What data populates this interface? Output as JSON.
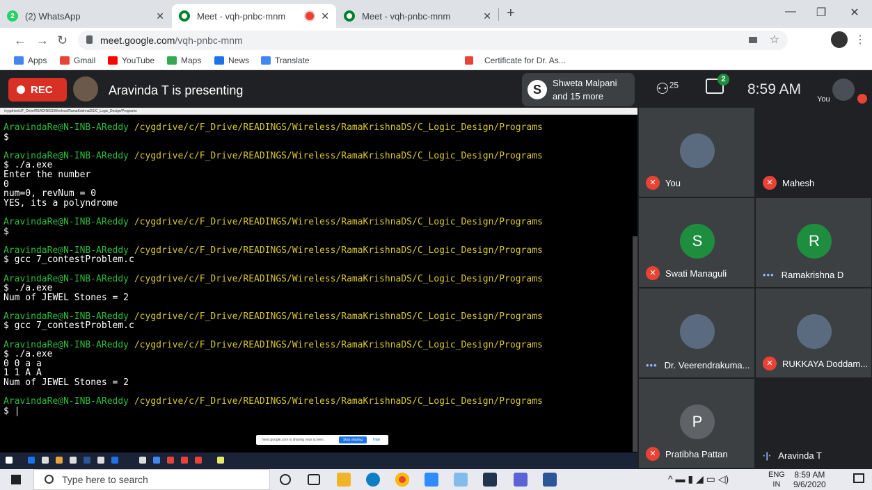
{
  "browser": {
    "tabs": [
      {
        "title": "(2) WhatsApp",
        "badge": "2"
      },
      {
        "title": "Meet - vqh-pnbc-mnm",
        "recording": true
      },
      {
        "title": "Meet - vqh-pnbc-mnm"
      }
    ],
    "new_tab": "+",
    "url_host": "meet.google.com",
    "url_path": "/vqh-pnbc-mnm",
    "bookmarks": [
      "Apps",
      "Gmail",
      "YouTube",
      "Maps",
      "News",
      "Translate",
      "Certificate for Dr. As..."
    ]
  },
  "meet_header": {
    "rec_label": "REC",
    "presenting_text": "Aravinda T is presenting",
    "viewers_line1": "Shweta Malpani",
    "viewers_line2": "and 15 more",
    "people_count": "25",
    "chat_badge": "2",
    "time": "8:59 AM",
    "you_label": "You"
  },
  "presentation": {
    "window_title": "/cygdrive/c/F_Drive/READINGS/Wireless/RamaKrishnaDS/C_Logic_Design/Programs",
    "terminal_lines": [
      {
        "t": "prompt",
        "user": "AravindaRe@N-INB-AReddy",
        "path": " /cygdrive/c/F_Drive/READINGS/Wireless/RamaKrishnaDS/C_Logic_Design/Programs"
      },
      {
        "t": "text",
        "text": "$"
      },
      {
        "t": "blank"
      },
      {
        "t": "prompt",
        "user": "AravindaRe@N-INB-AReddy",
        "path": " /cygdrive/c/F_Drive/READINGS/Wireless/RamaKrishnaDS/C_Logic_Design/Programs"
      },
      {
        "t": "text",
        "text": "$ ./a.exe"
      },
      {
        "t": "text",
        "text": "Enter the number"
      },
      {
        "t": "text",
        "text": "0"
      },
      {
        "t": "text",
        "text": "num=0, revNum = 0"
      },
      {
        "t": "text",
        "text": "YES, its a polyndrome"
      },
      {
        "t": "blank"
      },
      {
        "t": "prompt",
        "user": "AravindaRe@N-INB-AReddy",
        "path": " /cygdrive/c/F_Drive/READINGS/Wireless/RamaKrishnaDS/C_Logic_Design/Programs"
      },
      {
        "t": "text",
        "text": "$"
      },
      {
        "t": "blank"
      },
      {
        "t": "prompt",
        "user": "AravindaRe@N-INB-AReddy",
        "path": " /cygdrive/c/F_Drive/READINGS/Wireless/RamaKrishnaDS/C_Logic_Design/Programs"
      },
      {
        "t": "text",
        "text": "$ gcc 7_contestProblem.c"
      },
      {
        "t": "blank"
      },
      {
        "t": "prompt",
        "user": "AravindaRe@N-INB-AReddy",
        "path": " /cygdrive/c/F_Drive/READINGS/Wireless/RamaKrishnaDS/C_Logic_Design/Programs"
      },
      {
        "t": "text",
        "text": "$ ./a.exe"
      },
      {
        "t": "text",
        "text": "Num of JEWEL Stones = 2"
      },
      {
        "t": "blank"
      },
      {
        "t": "prompt",
        "user": "AravindaRe@N-INB-AReddy",
        "path": " /cygdrive/c/F_Drive/READINGS/Wireless/RamaKrishnaDS/C_Logic_Design/Programs"
      },
      {
        "t": "text",
        "text": "$ gcc 7_contestProblem.c"
      },
      {
        "t": "blank"
      },
      {
        "t": "prompt",
        "user": "AravindaRe@N-INB-AReddy",
        "path": " /cygdrive/c/F_Drive/READINGS/Wireless/RamaKrishnaDS/C_Logic_Design/Programs"
      },
      {
        "t": "text",
        "text": "$ ./a.exe"
      },
      {
        "t": "text",
        "text": "0 0 a a"
      },
      {
        "t": "text",
        "text": "1 1 A A"
      },
      {
        "t": "text",
        "text": "Num of JEWEL Stones = 2"
      },
      {
        "t": "blank"
      },
      {
        "t": "prompt",
        "user": "AravindaRe@N-INB-AReddy",
        "path": " /cygdrive/c/F_Drive/READINGS/Wireless/RamaKrishnaDS/C_Logic_Design/Programs"
      },
      {
        "t": "text",
        "text": "$ |"
      }
    ],
    "share_notice": "meet.google.com is sharing your screen.",
    "stop_sharing": "Stop sharing",
    "hide": "Hide"
  },
  "participants": [
    {
      "name": "You",
      "muted": true,
      "avatar": "photo",
      "color": "#3c4043"
    },
    {
      "name": "Mahesh",
      "muted": true,
      "avatar": "none",
      "color": "#202124"
    },
    {
      "name": "Swati Managuli",
      "muted": true,
      "avatar": "S",
      "color": "#1e8e3e"
    },
    {
      "name": "Ramakrishna D",
      "muted": false,
      "status": "dots",
      "avatar": "R",
      "color": "#1e8e3e"
    },
    {
      "name": "Dr. Veerendrakuma...",
      "muted": false,
      "status": "dots",
      "avatar": "photo",
      "color": "#3c4043"
    },
    {
      "name": "RUKKAYA Doddam...",
      "muted": true,
      "avatar": "photo",
      "color": "#3c4043"
    },
    {
      "name": "Pratibha Pattan",
      "muted": true,
      "avatar": "P",
      "color": "#5f6368"
    },
    {
      "name": "Aravinda T",
      "muted": false,
      "status": "bars",
      "avatar": "none",
      "color": "#202124"
    }
  ],
  "taskbar": {
    "search_placeholder": "Type here to search",
    "lang1": "ENG",
    "lang2": "IN",
    "time": "8:59 AM",
    "date": "9/6/2020"
  }
}
